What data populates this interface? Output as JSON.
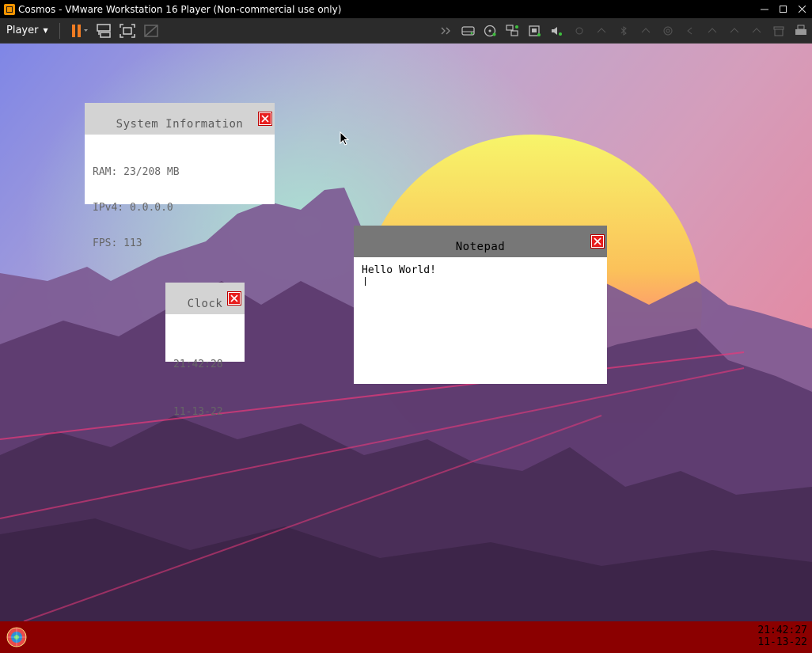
{
  "host": {
    "title": "Cosmos - VMware Workstation 16 Player (Non-commercial use only)",
    "player_menu_label": "Player",
    "window_controls": [
      "minimize-icon",
      "maximize-icon",
      "close-icon"
    ]
  },
  "toolbar": {
    "buttons": [
      "pause-icon",
      "send-ctrl-alt-del-icon",
      "fit-guest-icon",
      "unity-icon"
    ],
    "devices": [
      "expand-icon",
      "hard-disk-icon",
      "cd-dvd-icon",
      "network-adapter-icon",
      "usb-icon",
      "sound-icon"
    ]
  },
  "guest": {
    "system_info": {
      "title": "System Information",
      "lines": [
        "RAM: 23/208 MB",
        "IPv4: 0.0.0.0",
        "FPS: 113"
      ]
    },
    "clock": {
      "title": "Clock",
      "time": "21:42:28",
      "date": "11-13-22"
    },
    "notepad": {
      "title": "Notepad",
      "content": "Hello World!"
    },
    "taskbar": {
      "time": "21:42:27",
      "date": "11-13-22"
    }
  },
  "colors": {
    "taskbar": "#8b0000",
    "titlebar_window": "#d3d3d3",
    "notepad_titlebar": "#777777",
    "close_button": "#e81f1f"
  }
}
